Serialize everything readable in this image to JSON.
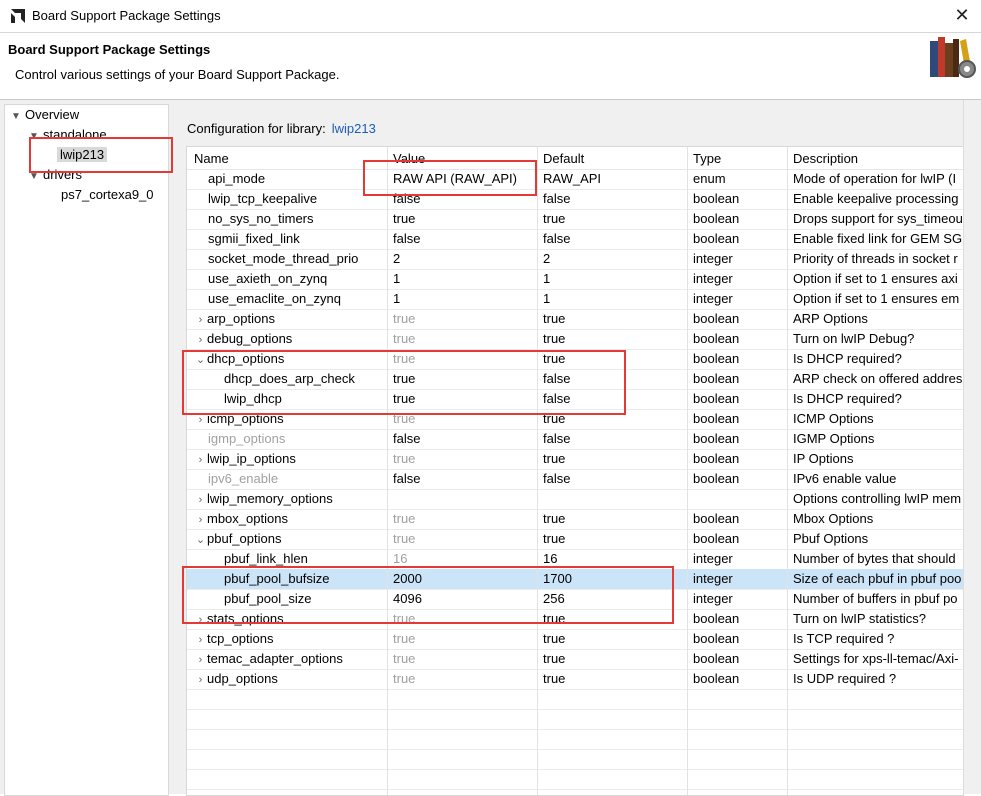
{
  "window": {
    "title": "Board Support Package Settings"
  },
  "header": {
    "title": "Board Support Package Settings",
    "subtitle": "Control various settings of your Board Support Package."
  },
  "tree": {
    "overview": "Overview",
    "standalone": "standalone",
    "lwip": "lwip213",
    "drivers": "drivers",
    "cpu": "ps7_cortexa9_0"
  },
  "config": {
    "label": "Configuration for library:",
    "library": "lwip213"
  },
  "columns": {
    "name": "Name",
    "value": "Value",
    "default": "Default",
    "type": "Type",
    "description": "Description"
  },
  "rows": [
    {
      "name": "api_mode",
      "value": "RAW API (RAW_API)",
      "default": "RAW_API",
      "type": "enum",
      "description": "Mode of operation for lwIP (I"
    },
    {
      "name": "lwip_tcp_keepalive",
      "value": "false",
      "default": "false",
      "type": "boolean",
      "description": "Enable keepalive processing"
    },
    {
      "name": "no_sys_no_timers",
      "value": "true",
      "default": "true",
      "type": "boolean",
      "description": "Drops support for sys_timeou"
    },
    {
      "name": "sgmii_fixed_link",
      "value": "false",
      "default": "false",
      "type": "boolean",
      "description": "Enable fixed link for GEM SGI"
    },
    {
      "name": "socket_mode_thread_prio",
      "value": "2",
      "default": "2",
      "type": "integer",
      "description": "Priority of threads in socket r"
    },
    {
      "name": "use_axieth_on_zynq",
      "value": "1",
      "default": "1",
      "type": "integer",
      "description": "Option if set to 1 ensures axi"
    },
    {
      "name": "use_emaclite_on_zynq",
      "value": "1",
      "default": "1",
      "type": "integer",
      "description": "Option if set to 1 ensures em"
    },
    {
      "name": "arp_options",
      "value": "true",
      "default": "true",
      "type": "boolean",
      "description": "ARP Options"
    },
    {
      "name": "debug_options",
      "value": "true",
      "default": "true",
      "type": "boolean",
      "description": "Turn on lwIP Debug?"
    },
    {
      "name": "dhcp_options",
      "value": "true",
      "default": "true",
      "type": "boolean",
      "description": "Is DHCP required?"
    },
    {
      "name": "dhcp_does_arp_check",
      "value": "true",
      "default": "false",
      "type": "boolean",
      "description": "ARP check on offered addres"
    },
    {
      "name": "lwip_dhcp",
      "value": "true",
      "default": "false",
      "type": "boolean",
      "description": "Is DHCP required?"
    },
    {
      "name": "icmp_options",
      "value": "true",
      "default": "true",
      "type": "boolean",
      "description": "ICMP Options"
    },
    {
      "name": "igmp_options",
      "value": "false",
      "default": "false",
      "type": "boolean",
      "description": "IGMP Options"
    },
    {
      "name": "lwip_ip_options",
      "value": "true",
      "default": "true",
      "type": "boolean",
      "description": "IP Options"
    },
    {
      "name": "ipv6_enable",
      "value": "false",
      "default": "false",
      "type": "boolean",
      "description": "IPv6 enable value"
    },
    {
      "name": "lwip_memory_options",
      "value": "",
      "default": "",
      "type": "",
      "description": "Options controlling lwIP mem"
    },
    {
      "name": "mbox_options",
      "value": "true",
      "default": "true",
      "type": "boolean",
      "description": "Mbox Options"
    },
    {
      "name": "pbuf_options",
      "value": "true",
      "default": "true",
      "type": "boolean",
      "description": "Pbuf Options"
    },
    {
      "name": "pbuf_link_hlen",
      "value": "16",
      "default": "16",
      "type": "integer",
      "description": "Number of bytes that should"
    },
    {
      "name": "pbuf_pool_bufsize",
      "value": "2000",
      "default": "1700",
      "type": "integer",
      "description": "Size of each pbuf in pbuf poo"
    },
    {
      "name": "pbuf_pool_size",
      "value": "4096",
      "default": "256",
      "type": "integer",
      "description": "Number of buffers in pbuf po"
    },
    {
      "name": "stats_options",
      "value": "true",
      "default": "true",
      "type": "boolean",
      "description": "Turn on lwIP statistics?"
    },
    {
      "name": "tcp_options",
      "value": "true",
      "default": "true",
      "type": "boolean",
      "description": "Is TCP required ?"
    },
    {
      "name": "temac_adapter_options",
      "value": "true",
      "default": "true",
      "type": "boolean",
      "description": "Settings for xps-ll-temac/Axi-"
    },
    {
      "name": "udp_options",
      "value": "true",
      "default": "true",
      "type": "boolean",
      "description": "Is UDP required ?"
    }
  ],
  "colors": {
    "accent": "#1a5fb4",
    "selection": "#cce4f7",
    "highlight_box": "#e53935"
  }
}
